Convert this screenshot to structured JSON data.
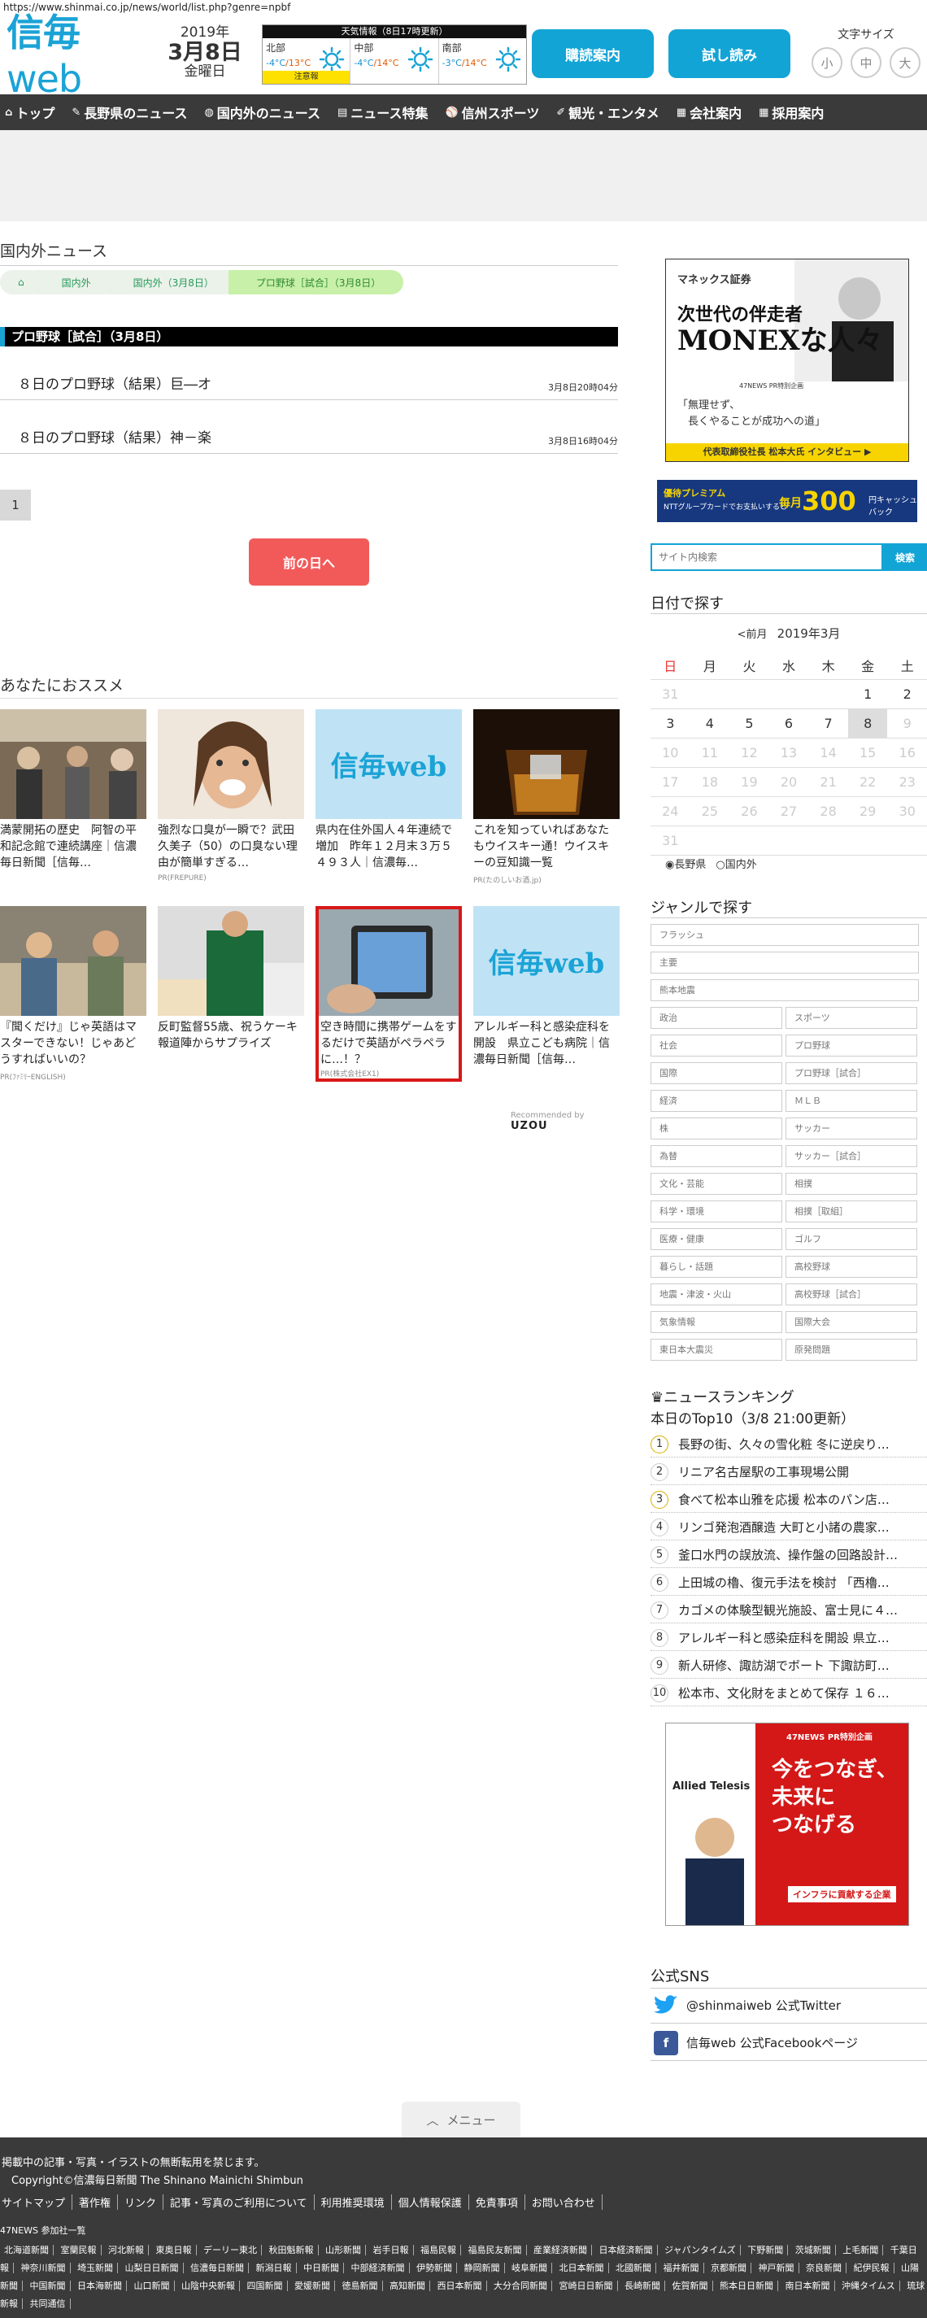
{
  "url": "https://www.shinmai.co.jp/news/world/list.php?genre=npbf",
  "header": {
    "logo_main": "信毎",
    "logo_sub": "web",
    "year": "2019年",
    "monthday": "3月8日",
    "weekday": "金曜日",
    "weather": {
      "title": "天気情報（8日17時更新）",
      "regions": [
        {
          "name": "北部",
          "lo": "-4°C",
          "hi": "/13°C",
          "warn": "注意報"
        },
        {
          "name": "中部",
          "lo": "-4°C",
          "hi": "/14°C",
          "warn": ""
        },
        {
          "name": "南部",
          "lo": "-3°C",
          "hi": "/14°C",
          "warn": ""
        }
      ]
    },
    "subscribe": "購読案内",
    "trial": "試し読み",
    "fontsize_label": "文字サイズ",
    "fontsizes": [
      "小",
      "中",
      "大"
    ]
  },
  "nav": [
    {
      "icon": "⌂",
      "label": "トップ"
    },
    {
      "icon": "✎",
      "label": "長野県のニュース"
    },
    {
      "icon": "◍",
      "label": "国内外のニュース"
    },
    {
      "icon": "▤",
      "label": "ニュース特集"
    },
    {
      "icon": "⚾",
      "label": "信州スポーツ"
    },
    {
      "icon": "✐",
      "label": "観光・エンタメ"
    },
    {
      "icon": "▦",
      "label": "会社案内"
    },
    {
      "icon": "▦",
      "label": "採用案内"
    }
  ],
  "main": {
    "section_title": "国内外ニュース",
    "breadcrumbs": [
      "国内外",
      "国内外（3月8日）",
      "プロ野球［試合］（3月8日）"
    ],
    "category": "プロ野球［試合］（3月8日）",
    "articles": [
      {
        "title": "８日のプロ野球（結果）巨―オ",
        "date": "3月8日20時04分"
      },
      {
        "title": "８日のプロ野球（結果）神－楽",
        "date": "3月8日16時04分"
      }
    ],
    "page": "1",
    "prev_day": "前の日へ",
    "rec_title": "あなたにおススメ",
    "cards": [
      {
        "caption": "満蒙開拓の歴史　阿智の平和記念館で連続講座｜信濃毎日新聞［信毎…",
        "pr": ""
      },
      {
        "caption": "強烈な口臭が一瞬で？武田久美子（50）の口臭ない理由が簡単すぎる…",
        "pr": "PR(FREPURE)"
      },
      {
        "caption": "県内在住外国人４年連続で増加　昨年１２月末３万５４９３人｜信濃毎…",
        "pr": ""
      },
      {
        "caption": "これを知っていればあなたもウイスキー通！ウイスキーの豆知識一覧",
        "pr": "PR(たのしいお酒.jp)"
      },
      {
        "caption": "『聞くだけ』じゃ英語はマスターできない！じゃあどうすればいいの？",
        "pr": "PR(ﾌｧﾐﾘｰENGLISH)"
      },
      {
        "caption": "反町監督55歳、祝うケーキ　報道陣からサプライズ",
        "pr": ""
      },
      {
        "caption": "空き時間に携帯ゲームをするだけで英語がペラペラに…！？",
        "pr": "PR(株式会社EX1)"
      },
      {
        "caption": "アレルギー科と感染症科を開設　県立こども病院｜信濃毎日新聞［信毎…",
        "pr": ""
      }
    ],
    "thumb_logo": "信毎web",
    "recommended_by": "Recommended by",
    "uzou": "UZOU"
  },
  "sidebar": {
    "ad1": {
      "brand": "マネックス証券",
      "line1": "次世代の伴走者",
      "line2": "MONEXな人々",
      "tag": "47NEWS PR特別企画",
      "quote": "「無理せず、\n　長くやることが成功への道」",
      "footer": "代表取締役社長 松本大氏 インタビュー ▶"
    },
    "ad2": {
      "a": "優待プレミアム",
      "b": "NTTグループカードでお支払いすると",
      "c": "毎月",
      "d": "300",
      "e": "円キャッシュバック"
    },
    "search_placeholder": "サイト内検索",
    "search_btn": "検索",
    "date_title": "日付で探す",
    "cal_prev": "<前月",
    "cal_month": "2019年3月",
    "weekdays": [
      "日",
      "月",
      "火",
      "水",
      "木",
      "金",
      "土"
    ],
    "weeks": [
      [
        "31",
        "",
        "",
        "",
        "",
        "1",
        "2"
      ],
      [
        "3",
        "4",
        "5",
        "6",
        "7",
        "8",
        "9"
      ],
      [
        "10",
        "11",
        "12",
        "13",
        "14",
        "15",
        "16"
      ],
      [
        "17",
        "18",
        "19",
        "20",
        "21",
        "22",
        "23"
      ],
      [
        "24",
        "25",
        "26",
        "27",
        "28",
        "29",
        "30"
      ],
      [
        "31",
        "",
        "",
        "",
        "",
        "",
        ""
      ]
    ],
    "cal_opt1": "長野県",
    "cal_opt2": "国内外",
    "genre_title": "ジャンルで探す",
    "genres_full": [
      "フラッシュ",
      "主要",
      "熊本地震"
    ],
    "genres_pairs": [
      [
        "政治",
        "スポーツ"
      ],
      [
        "社会",
        "プロ野球"
      ],
      [
        "国際",
        "プロ野球［試合］"
      ],
      [
        "経済",
        "ＭＬＢ"
      ],
      [
        "株",
        "サッカー"
      ],
      [
        "為替",
        "サッカー［試合］"
      ],
      [
        "文化・芸能",
        "相撲"
      ],
      [
        "科学・環境",
        "相撲［取組］"
      ],
      [
        "医療・健康",
        "ゴルフ"
      ],
      [
        "暮らし・話題",
        "高校野球"
      ],
      [
        "地震・津波・火山",
        "高校野球［試合］"
      ],
      [
        "気象情報",
        "国際大会"
      ],
      [
        "東日本大震災",
        "原発問題"
      ]
    ],
    "rank_title": "ニュースランキング",
    "rank_sub": "本日のTop10（3/8 21:00更新）",
    "ranking": [
      "長野の街、久々の雪化粧 冬に逆戻り…",
      "リニア名古屋駅の工事現場公開",
      "食べて松本山雅を応援 松本のパン店…",
      "リンゴ発泡酒醸造 大町と小諸の農家…",
      "釜口水門の誤放流、操作盤の回路設計…",
      "上田城の櫓、復元手法を検討 「西櫓…",
      "カゴメの体験型観光施設、富士見に４…",
      "アレルギー科と感染症科を開設 県立…",
      "新人研修、諏訪湖でボート 下諏訪町…",
      "松本市、文化財をまとめて保存 １６…"
    ],
    "ad3": {
      "logo": "Allied Telesis",
      "pr": "47NEWS PR特別企画",
      "big": "今をつなぎ、\n未来に\nつなげる",
      "sm": "インフラに貢献する企業"
    },
    "sns_title": "公式SNS",
    "twitter": "@shinmaiweb 公式Twitter",
    "facebook": "信毎web 公式Facebookページ"
  },
  "footer": {
    "menu": "メニュー",
    "notice": "掲載中の記事・写真・イラストの無断転用を禁じます。",
    "copyright": "Copyright©信濃毎日新聞 The Shinano Mainichi Shimbun",
    "links": [
      "サイトマップ",
      "著作権",
      "リンク",
      "記事・写真のご利用について",
      "利用推奨環境",
      "個人情報保護",
      "免責事項",
      "お問い合わせ"
    ],
    "papers_title": "47NEWS 参加社一覧",
    "papers": [
      "北海道新聞",
      "室蘭民報",
      "河北新報",
      "東奥日報",
      "デーリー東北",
      "秋田魁新報",
      "山形新聞",
      "岩手日報",
      "福島民報",
      "福島民友新聞",
      "産業経済新聞",
      "日本経済新聞",
      "ジャパンタイムズ",
      "下野新聞",
      "茨城新聞",
      "上毛新聞",
      "千葉日報",
      "神奈川新聞",
      "埼玉新聞",
      "山梨日日新聞",
      "信濃毎日新聞",
      "新潟日報",
      "中日新聞",
      "中部経済新聞",
      "伊勢新聞",
      "静岡新聞",
      "岐阜新聞",
      "北日本新聞",
      "北國新聞",
      "福井新聞",
      "京都新聞",
      "神戸新聞",
      "奈良新聞",
      "紀伊民報",
      "山陽新聞",
      "中国新聞",
      "日本海新聞",
      "山口新聞",
      "山陰中央新報",
      "四国新聞",
      "愛媛新聞",
      "徳島新聞",
      "高知新聞",
      "西日本新聞",
      "大分合同新聞",
      "宮崎日日新聞",
      "長崎新聞",
      "佐賀新聞",
      "熊本日日新聞",
      "南日本新聞",
      "沖縄タイムス",
      "琉球新報",
      "共同通信"
    ]
  },
  "colors": {
    "brand": "#1ba3d6",
    "nav": "#3a3a3a",
    "accent_red": "#f25a5a"
  }
}
